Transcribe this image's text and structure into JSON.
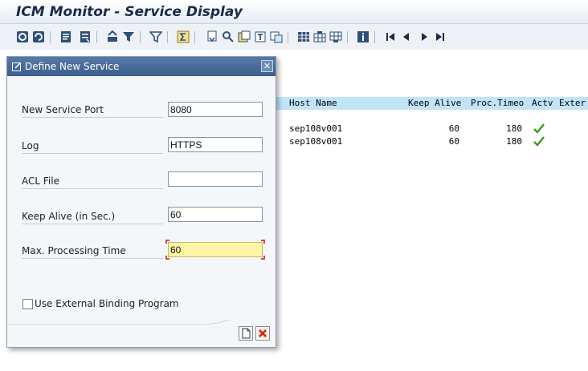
{
  "window": {
    "title": "ICM Monitor - Service Display"
  },
  "toolbar": {
    "icons": [
      "refresh-icon",
      "details-icon",
      "layout-icon",
      "print-icon",
      "filter-icon",
      "sum-icon",
      "export-icon",
      "find-icon",
      "first-page-icon",
      "prev-page-icon",
      "next-page-icon",
      "last-page-icon",
      "info-icon"
    ]
  },
  "table": {
    "headers": {
      "host": "Host Name",
      "keepalive": "Keep Alive",
      "proctimeo": "Proc.Timeo",
      "actv": "Actv",
      "exter": "Exter"
    },
    "rows": [
      {
        "host": "sep108v001",
        "keepalive": "60",
        "proctimeo": "180"
      },
      {
        "host": "sep108v001",
        "keepalive": "60",
        "proctimeo": "180"
      }
    ]
  },
  "dialog": {
    "title": "Define New Service",
    "fields": {
      "port": {
        "label": "New Service Port",
        "value": "8080"
      },
      "log": {
        "label": "Log",
        "value": "HTTPS"
      },
      "acl": {
        "label": "ACL File",
        "value": ""
      },
      "keepalive": {
        "label": "Keep Alive (in Sec.)",
        "value": "60"
      },
      "maxproc": {
        "label": "Max. Processing Time",
        "value": "60"
      }
    },
    "checkbox": {
      "label": "Use External Binding Program"
    }
  },
  "colors": {
    "accent": "#3c5f8d",
    "header": "#c1e4f7",
    "focus": "#fff5a6",
    "check": "#3a9a1e"
  }
}
